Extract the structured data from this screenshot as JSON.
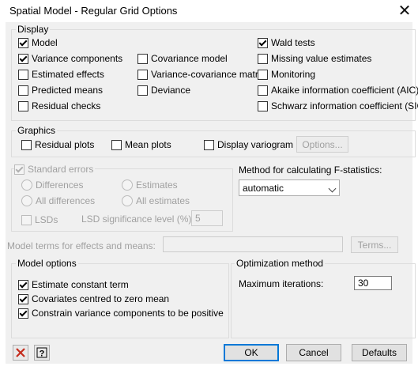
{
  "window": {
    "title": "Spatial Model - Regular Grid Options",
    "close_glyph": "✕"
  },
  "display": {
    "title": "Display",
    "items": [
      {
        "label": "Model",
        "checked": true
      },
      {
        "label": "Variance components",
        "checked": true
      },
      {
        "label": "Estimated effects",
        "checked": false
      },
      {
        "label": "Predicted means",
        "checked": false
      },
      {
        "label": "Residual checks",
        "checked": false
      },
      {
        "label": "Covariance model",
        "checked": false
      },
      {
        "label": "Variance-covariance matrix",
        "checked": false
      },
      {
        "label": "Deviance",
        "checked": false
      },
      {
        "label": "Wald tests",
        "checked": true
      },
      {
        "label": "Missing value estimates",
        "checked": false
      },
      {
        "label": "Monitoring",
        "checked": false
      },
      {
        "label": "Akaike information coefficient (AIC)",
        "checked": false
      },
      {
        "label": "Schwarz information coefficient (SIC)",
        "checked": false
      }
    ]
  },
  "graphics": {
    "title": "Graphics",
    "items": [
      {
        "label": "Residual plots",
        "checked": false
      },
      {
        "label": "Mean plots",
        "checked": false
      },
      {
        "label": "Display variogram",
        "checked": false
      }
    ],
    "options_button": "Options..."
  },
  "standard_errors": {
    "label": "Standard errors",
    "checked": true,
    "radios": [
      "Differences",
      "Estimates",
      "All differences",
      "All estimates"
    ],
    "lsds_label": "LSDs",
    "lsd_level_label": "LSD significance level (%):",
    "lsd_level_value": "5"
  },
  "fstat": {
    "label": "Method for calculating F-statistics:",
    "value": "automatic"
  },
  "model_terms": {
    "label": "Model terms for effects and means:",
    "value": "",
    "button": "Terms..."
  },
  "model_options": {
    "title": "Model options",
    "items": [
      {
        "label": "Estimate constant term",
        "checked": true
      },
      {
        "label": "Covariates centred to zero mean",
        "checked": true
      },
      {
        "label": "Constrain variance components to be positive",
        "checked": true
      }
    ]
  },
  "optimization": {
    "title": "Optimization method",
    "max_iter_label": "Maximum iterations:",
    "max_iter_value": "30"
  },
  "buttons": {
    "ok": "OK",
    "cancel": "Cancel",
    "defaults": "Defaults"
  },
  "icons": {
    "clear": "red-x-icon",
    "help": "help-icon",
    "clear_color": "#c42b1c"
  }
}
